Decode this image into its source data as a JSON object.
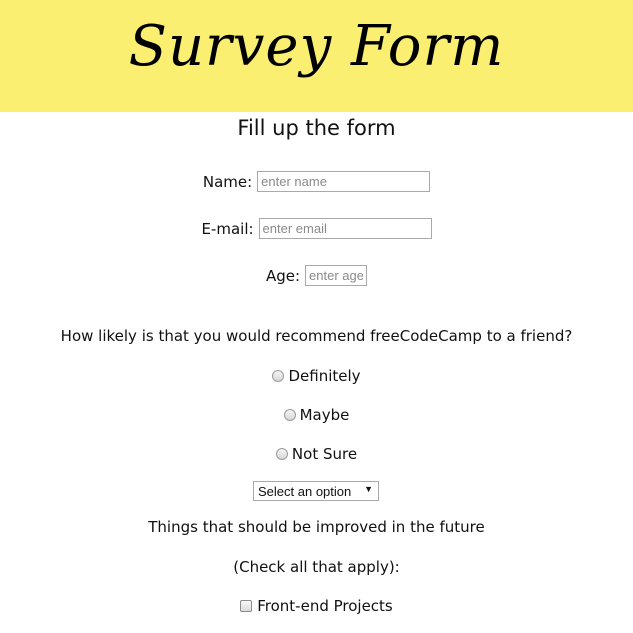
{
  "header": {
    "title": "Survey Form"
  },
  "subtitle": "Fill up the form",
  "fields": {
    "name": {
      "label": "Name:",
      "placeholder": "enter name"
    },
    "email": {
      "label": "E-mail:",
      "placeholder": "enter email"
    },
    "age": {
      "label": "Age:",
      "placeholder": "enter age"
    }
  },
  "recommend": {
    "question": "How likely is that you would recommend freeCodeCamp to a friend?",
    "options": [
      "Definitely",
      "Maybe",
      "Not Sure"
    ]
  },
  "dropdown": {
    "selected": "Select an option"
  },
  "improvements": {
    "heading": "Things that should be improved in the future",
    "subheading": "(Check all that apply):",
    "options": [
      "Front-end Projects"
    ]
  },
  "colors": {
    "header_bg": "#faef71"
  }
}
